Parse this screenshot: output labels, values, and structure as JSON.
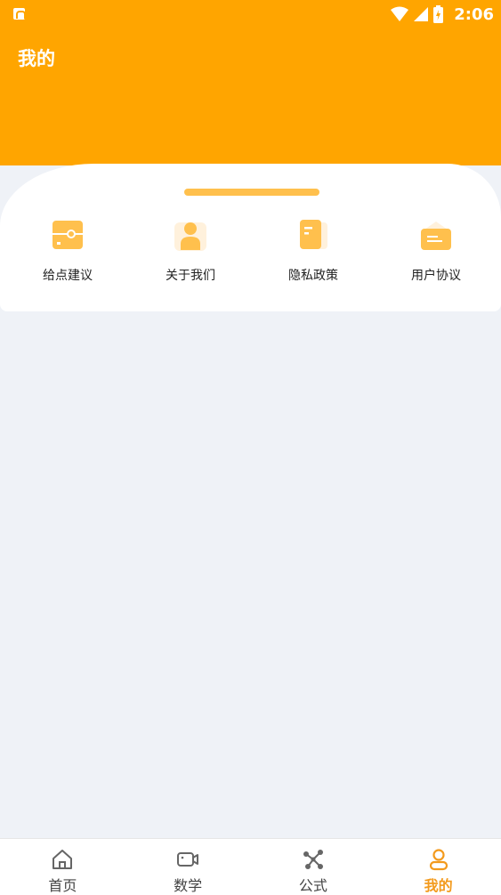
{
  "status_bar": {
    "time": "2:06",
    "app_icon": "app-store-icon",
    "icons": [
      "wifi-icon",
      "signal-icon",
      "battery-icon"
    ]
  },
  "header": {
    "title": "我的"
  },
  "menu": {
    "items": [
      {
        "label": "给点建议",
        "icon": "feedback-icon"
      },
      {
        "label": "关于我们",
        "icon": "about-us-icon"
      },
      {
        "label": "隐私政策",
        "icon": "privacy-policy-icon"
      },
      {
        "label": "用户协议",
        "icon": "user-agreement-icon"
      }
    ]
  },
  "tabbar": {
    "active_index": 3,
    "active_color": "#f39a1c",
    "tabs": [
      {
        "label": "首页",
        "icon": "home-icon"
      },
      {
        "label": "数学",
        "icon": "video-icon"
      },
      {
        "label": "公式",
        "icon": "formula-icon"
      },
      {
        "label": "我的",
        "icon": "profile-icon"
      }
    ]
  },
  "colors": {
    "brand": "#ffa500",
    "accent_light": "#ffc04d",
    "background": "#eff2f7"
  }
}
